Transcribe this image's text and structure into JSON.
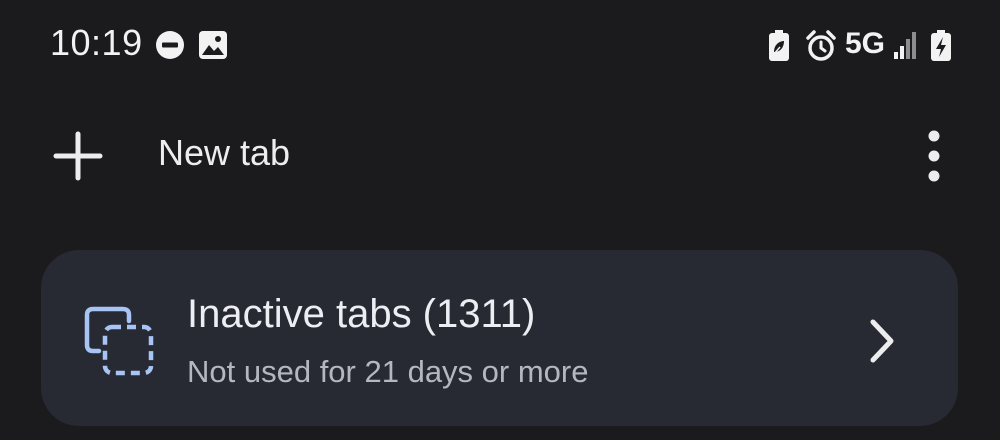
{
  "status_bar": {
    "time": "10:19",
    "left_icons": [
      "do-not-disturb-icon",
      "image-icon"
    ],
    "right_icons": [
      "battery-saver-icon",
      "alarm-icon",
      "signal-icon",
      "battery-charging-icon"
    ],
    "network": "5G"
  },
  "toolbar": {
    "new_tab_label": "New tab",
    "add_icon": "plus-icon",
    "menu_icon": "more-vert-icon"
  },
  "inactive_card": {
    "title": "Inactive tabs (1311)",
    "subtitle": "Not used for 21 days or more",
    "icon": "inactive-tabs-icon",
    "chevron": "chevron-right-icon",
    "accent": "#a8c4f5"
  },
  "colors": {
    "background": "#1b1b1d",
    "card": "#272a33",
    "text": "#e8e8ea",
    "subtext": "#b4b7bf"
  }
}
